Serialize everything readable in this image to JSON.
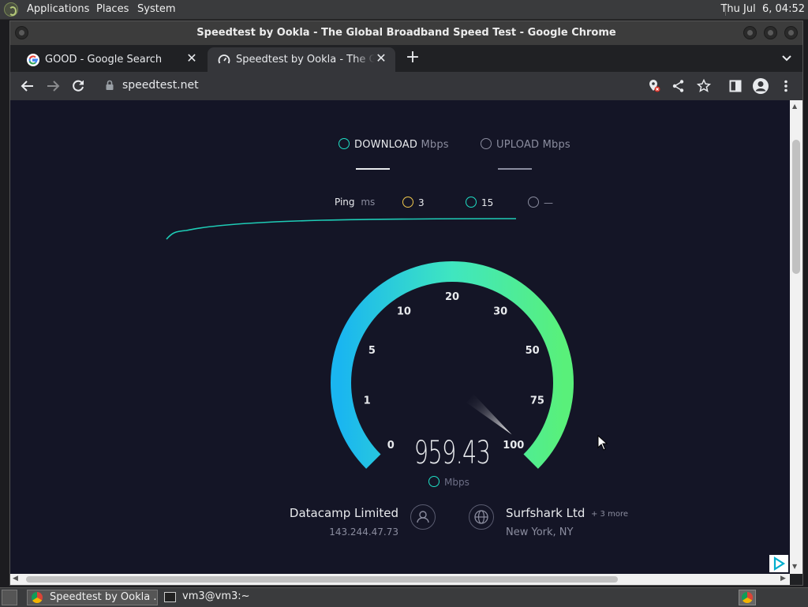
{
  "desktop": {
    "menu": [
      "Applications",
      "Places",
      "System"
    ],
    "clock": "Thu Jul  6, 04:52"
  },
  "window": {
    "title": "Speedtest by Ookla - The Global Broadband Speed Test - Google Chrome"
  },
  "tabs": [
    {
      "label": "GOOD - Google Search",
      "favicon": "google-icon",
      "active": false
    },
    {
      "label": "Speedtest by Ookla - The Global Broadband Speed Test",
      "favicon": "speedtest-icon",
      "active": true
    }
  ],
  "toolbar": {
    "url": "speedtest.net"
  },
  "speedtest": {
    "download_label": "DOWNLOAD",
    "upload_label": "UPLOAD",
    "unit_label": "Mbps",
    "ping_label": "Ping",
    "ping_unit": "ms",
    "ping_idle": "3",
    "ping_down": "15",
    "ping_up": "—",
    "speed": "959.43",
    "speed_unit": "Mbps",
    "gauge_ticks": [
      "0",
      "1",
      "5",
      "10",
      "20",
      "30",
      "50",
      "75",
      "100"
    ],
    "needle_fraction": 0.985,
    "isp": {
      "name": "Datacamp Limited",
      "ip": "143.244.47.73"
    },
    "server": {
      "name": "Surfshark Ltd",
      "more": "+ 3 more",
      "location": "New York, NY"
    }
  },
  "taskbar": {
    "items": [
      "Speedtest by Ookla ...",
      "vm3@vm3:~"
    ]
  },
  "colors": {
    "accent": "#1fe0c6",
    "gauge_start": "#1ab6f0",
    "gauge_end": "#59f07a",
    "page_bg": "#141526"
  }
}
